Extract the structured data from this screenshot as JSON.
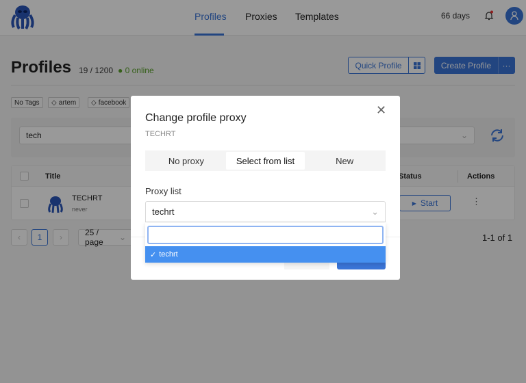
{
  "header": {
    "nav": [
      {
        "label": "Profiles",
        "active": true
      },
      {
        "label": "Proxies"
      },
      {
        "label": "Templates"
      }
    ],
    "days": "66 days",
    "accent": "#3a74d6"
  },
  "page": {
    "title": "Profiles",
    "count": "19 / 1200",
    "online": "0 online",
    "quick_profile": "Quick Profile",
    "create_profile": "Create Profile",
    "more": "···"
  },
  "tags": [
    "No Tags",
    "artem",
    "facebook"
  ],
  "filters": {
    "search_value": "tech",
    "sort_partial": "↓"
  },
  "table": {
    "columns": {
      "title": "Title",
      "status": "Status",
      "actions": "Actions"
    },
    "rows": [
      {
        "title": "TECHRT",
        "last": "never",
        "start": "Start"
      }
    ]
  },
  "pagination": {
    "current": "1",
    "page_size": "25 / page",
    "range": "1-1 of 1"
  },
  "modal": {
    "title": "Change profile proxy",
    "subtitle": "TECHRT",
    "tabs": [
      "No proxy",
      "Select from list",
      "New"
    ],
    "active_tab": "Select from list",
    "proxy_label": "Proxy list",
    "proxy_value": "techrt",
    "dropdown": {
      "search_value": "",
      "options": [
        {
          "label": "techrt",
          "selected": true
        }
      ]
    }
  }
}
